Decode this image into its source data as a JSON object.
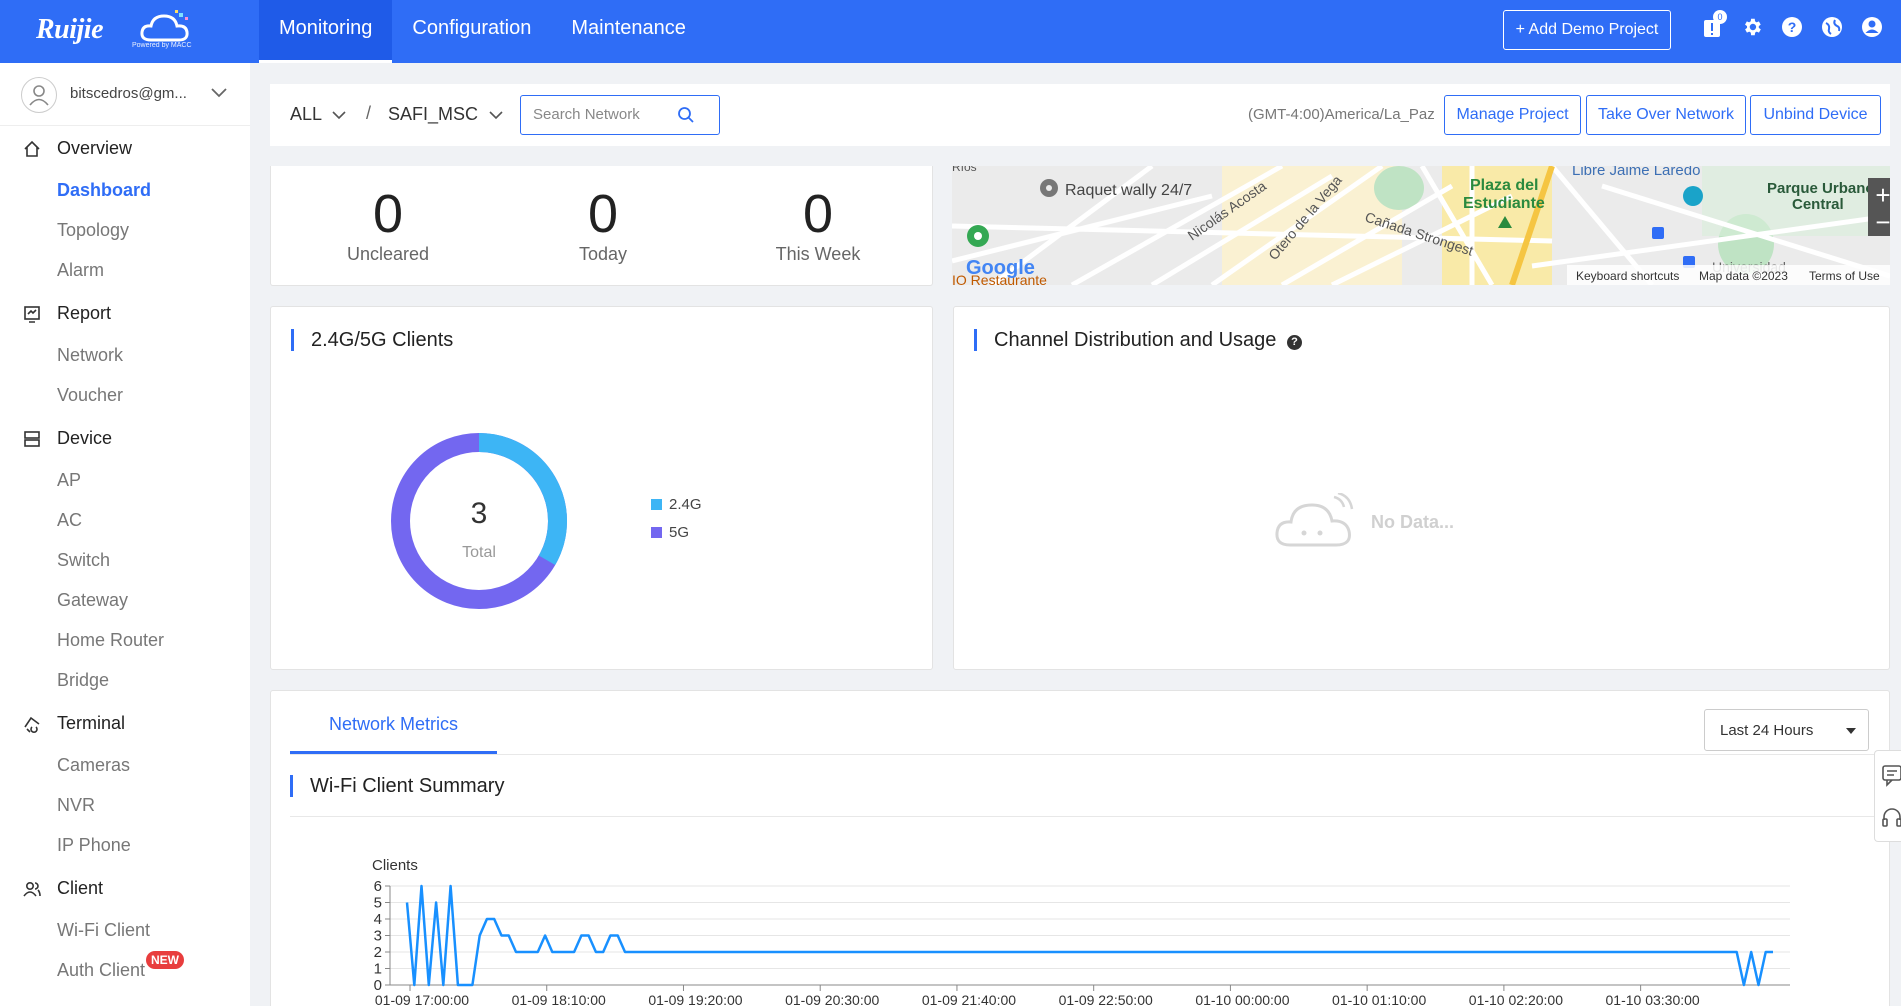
{
  "brand": {
    "logo_text": "Ruijie",
    "sub_text": "Powered by MACC"
  },
  "nav": {
    "items": [
      "Monitoring",
      "Configuration",
      "Maintenance"
    ],
    "active": 0
  },
  "header": {
    "demo_label": "+ Add Demo Project",
    "notification_count": "0"
  },
  "user": {
    "name": "bitscedros@gm..."
  },
  "sidebar": {
    "groups": [
      {
        "label": "Overview",
        "icon": "home-icon",
        "items": [
          "Dashboard",
          "Topology",
          "Alarm"
        ]
      },
      {
        "label": "Report",
        "icon": "report-icon",
        "items": [
          "Network",
          "Voucher"
        ]
      },
      {
        "label": "Device",
        "icon": "device-icon",
        "items": [
          "AP",
          "AC",
          "Switch",
          "Gateway",
          "Home Router",
          "Bridge"
        ]
      },
      {
        "label": "Terminal",
        "icon": "terminal-icon",
        "items": [
          "Cameras",
          "NVR",
          "IP Phone"
        ]
      },
      {
        "label": "Client",
        "icon": "client-icon",
        "items": [
          "Wi-Fi Client",
          "Auth Client"
        ]
      }
    ],
    "active_item": "Dashboard",
    "new_badge": "NEW"
  },
  "filter": {
    "scope": "ALL",
    "slash": "/",
    "project": "SAFI_MSC",
    "search_placeholder": "Search Network",
    "timezone": "(GMT-4:00)America/La_Paz",
    "buttons": [
      "Manage Project",
      "Take Over Network",
      "Unbind Device"
    ]
  },
  "alarms": {
    "stats": [
      {
        "value": "0",
        "label": "Uncleared"
      },
      {
        "value": "0",
        "label": "Today"
      },
      {
        "value": "0",
        "label": "This Week"
      }
    ]
  },
  "map": {
    "labels": [
      "Raquet wally 24/7",
      "Nicolás Acosta",
      "Otero de la Vega",
      "Cañada Strongest",
      "Plaza del",
      "Estudiante",
      "Libre Jaime Laredo",
      "Parque Urbano",
      "Central",
      "Universidad",
      "IO Restaurante",
      "Ríos"
    ],
    "google": "Google",
    "footer": [
      "Keyboard shortcuts",
      "Map data ©2023",
      "Terms of Use"
    ],
    "zoom_in": "+",
    "zoom_out": "−"
  },
  "clients_card": {
    "title": "2.4G/5G Clients",
    "total_value": "3",
    "total_label": "Total",
    "colors": {
      "g24": "#3db5f5",
      "g5": "#7367f0"
    }
  },
  "channel_card": {
    "title": "Channel Distribution and Usage",
    "help": "?",
    "no_data": "No Data..."
  },
  "metrics": {
    "tab": "Network Metrics",
    "range": "Last 24 Hours",
    "section_title": "Wi-Fi Client Summary"
  },
  "chart_data": {
    "type": "line",
    "ylabel": "Clients",
    "ylim": [
      0,
      6
    ],
    "yticks": [
      "0",
      "1",
      "2",
      "3",
      "4",
      "5",
      "6"
    ],
    "xticks": [
      "01-09 17:00:00",
      "01-09 18:10:00",
      "01-09 19:20:00",
      "01-09 20:30:00",
      "01-09 21:40:00",
      "01-09 22:50:00",
      "01-10 00:00:00",
      "01-10 01:10:00",
      "01-10 02:20:00",
      "01-10 03:30:00"
    ],
    "color": "#1890ff",
    "series": [
      {
        "values": [
          5,
          0,
          6,
          0,
          5,
          0,
          6,
          0,
          0,
          0,
          3,
          4,
          4,
          3,
          3,
          2,
          2,
          2,
          2,
          3,
          2,
          2,
          2,
          2,
          3,
          3,
          2,
          2,
          3,
          3,
          2,
          2,
          2,
          2,
          2,
          2,
          2,
          2,
          2,
          2,
          2,
          2,
          2,
          2,
          2,
          2,
          2,
          2,
          2,
          2,
          2,
          2,
          2,
          2,
          2,
          2,
          2,
          2,
          2,
          2,
          2,
          2,
          2,
          2,
          2,
          2,
          2,
          2,
          2,
          2,
          2,
          2,
          2,
          2,
          2,
          2,
          2,
          2,
          2,
          2,
          2,
          2,
          2,
          2,
          2,
          2,
          2,
          2,
          2,
          2,
          2,
          2,
          2,
          2,
          2,
          2,
          2,
          2,
          2,
          2,
          2,
          2,
          2,
          2,
          2,
          2,
          2,
          2,
          2,
          2,
          2,
          2,
          2,
          2,
          2,
          2,
          2,
          2,
          2,
          2,
          2,
          2,
          2,
          2,
          2,
          2,
          2,
          2,
          2,
          2,
          2,
          2,
          2,
          2,
          2,
          2,
          2,
          2,
          2,
          2,
          2,
          2,
          2,
          2,
          2,
          2,
          2,
          2,
          2,
          2,
          2,
          2,
          2,
          2,
          2,
          2,
          2,
          2,
          2,
          2,
          2,
          2,
          2,
          2,
          2,
          2,
          2,
          2,
          2,
          2,
          2,
          2,
          2,
          2,
          2,
          2,
          2,
          2,
          2,
          2,
          2,
          2,
          2,
          2,
          0,
          2,
          0,
          2,
          2
        ]
      }
    ]
  }
}
